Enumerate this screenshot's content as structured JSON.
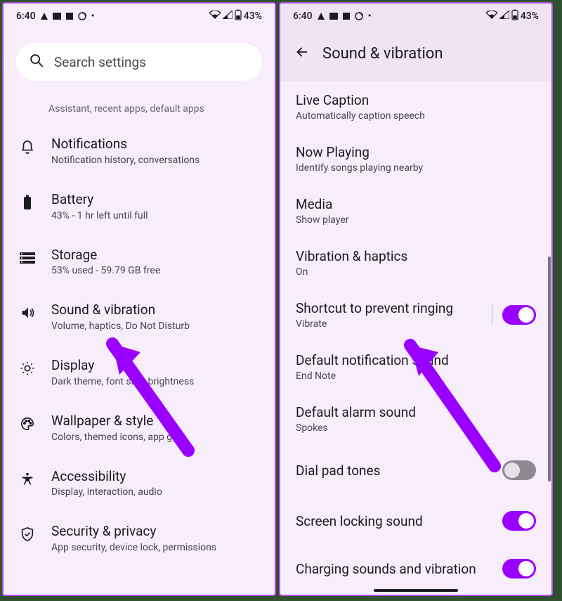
{
  "status": {
    "time": "6:40",
    "battery": "43%"
  },
  "left": {
    "search_placeholder": "Search settings",
    "truncated": "Assistant, recent apps, default apps",
    "items": [
      {
        "title": "Notifications",
        "sub": "Notification history, conversations"
      },
      {
        "title": "Battery",
        "sub": "43% - 1 hr left until full"
      },
      {
        "title": "Storage",
        "sub": "53% used - 59.79 GB free"
      },
      {
        "title": "Sound & vibration",
        "sub": "Volume, haptics, Do Not Disturb"
      },
      {
        "title": "Display",
        "sub": "Dark theme, font size, brightness"
      },
      {
        "title": "Wallpaper & style",
        "sub": "Colors, themed icons, app grid"
      },
      {
        "title": "Accessibility",
        "sub": "Display, interaction, audio"
      },
      {
        "title": "Security & privacy",
        "sub": "App security, device lock, permissions"
      }
    ]
  },
  "right": {
    "header": "Sound & vibration",
    "items": [
      {
        "title": "Live Caption",
        "sub": "Automatically caption speech"
      },
      {
        "title": "Now Playing",
        "sub": "Identify songs playing nearby"
      },
      {
        "title": "Media",
        "sub": "Show player"
      },
      {
        "title": "Vibration & haptics",
        "sub": "On"
      },
      {
        "title": "Shortcut to prevent ringing",
        "sub": "Vibrate",
        "toggle": "on",
        "divider": true
      },
      {
        "title": "Default notification sound",
        "sub": "End Note"
      },
      {
        "title": "Default alarm sound",
        "sub": "Spokes"
      },
      {
        "title": "Dial pad tones",
        "toggle": "off"
      },
      {
        "title": "Screen locking sound",
        "toggle": "on"
      },
      {
        "title": "Charging sounds and vibration",
        "toggle": "on"
      }
    ]
  }
}
